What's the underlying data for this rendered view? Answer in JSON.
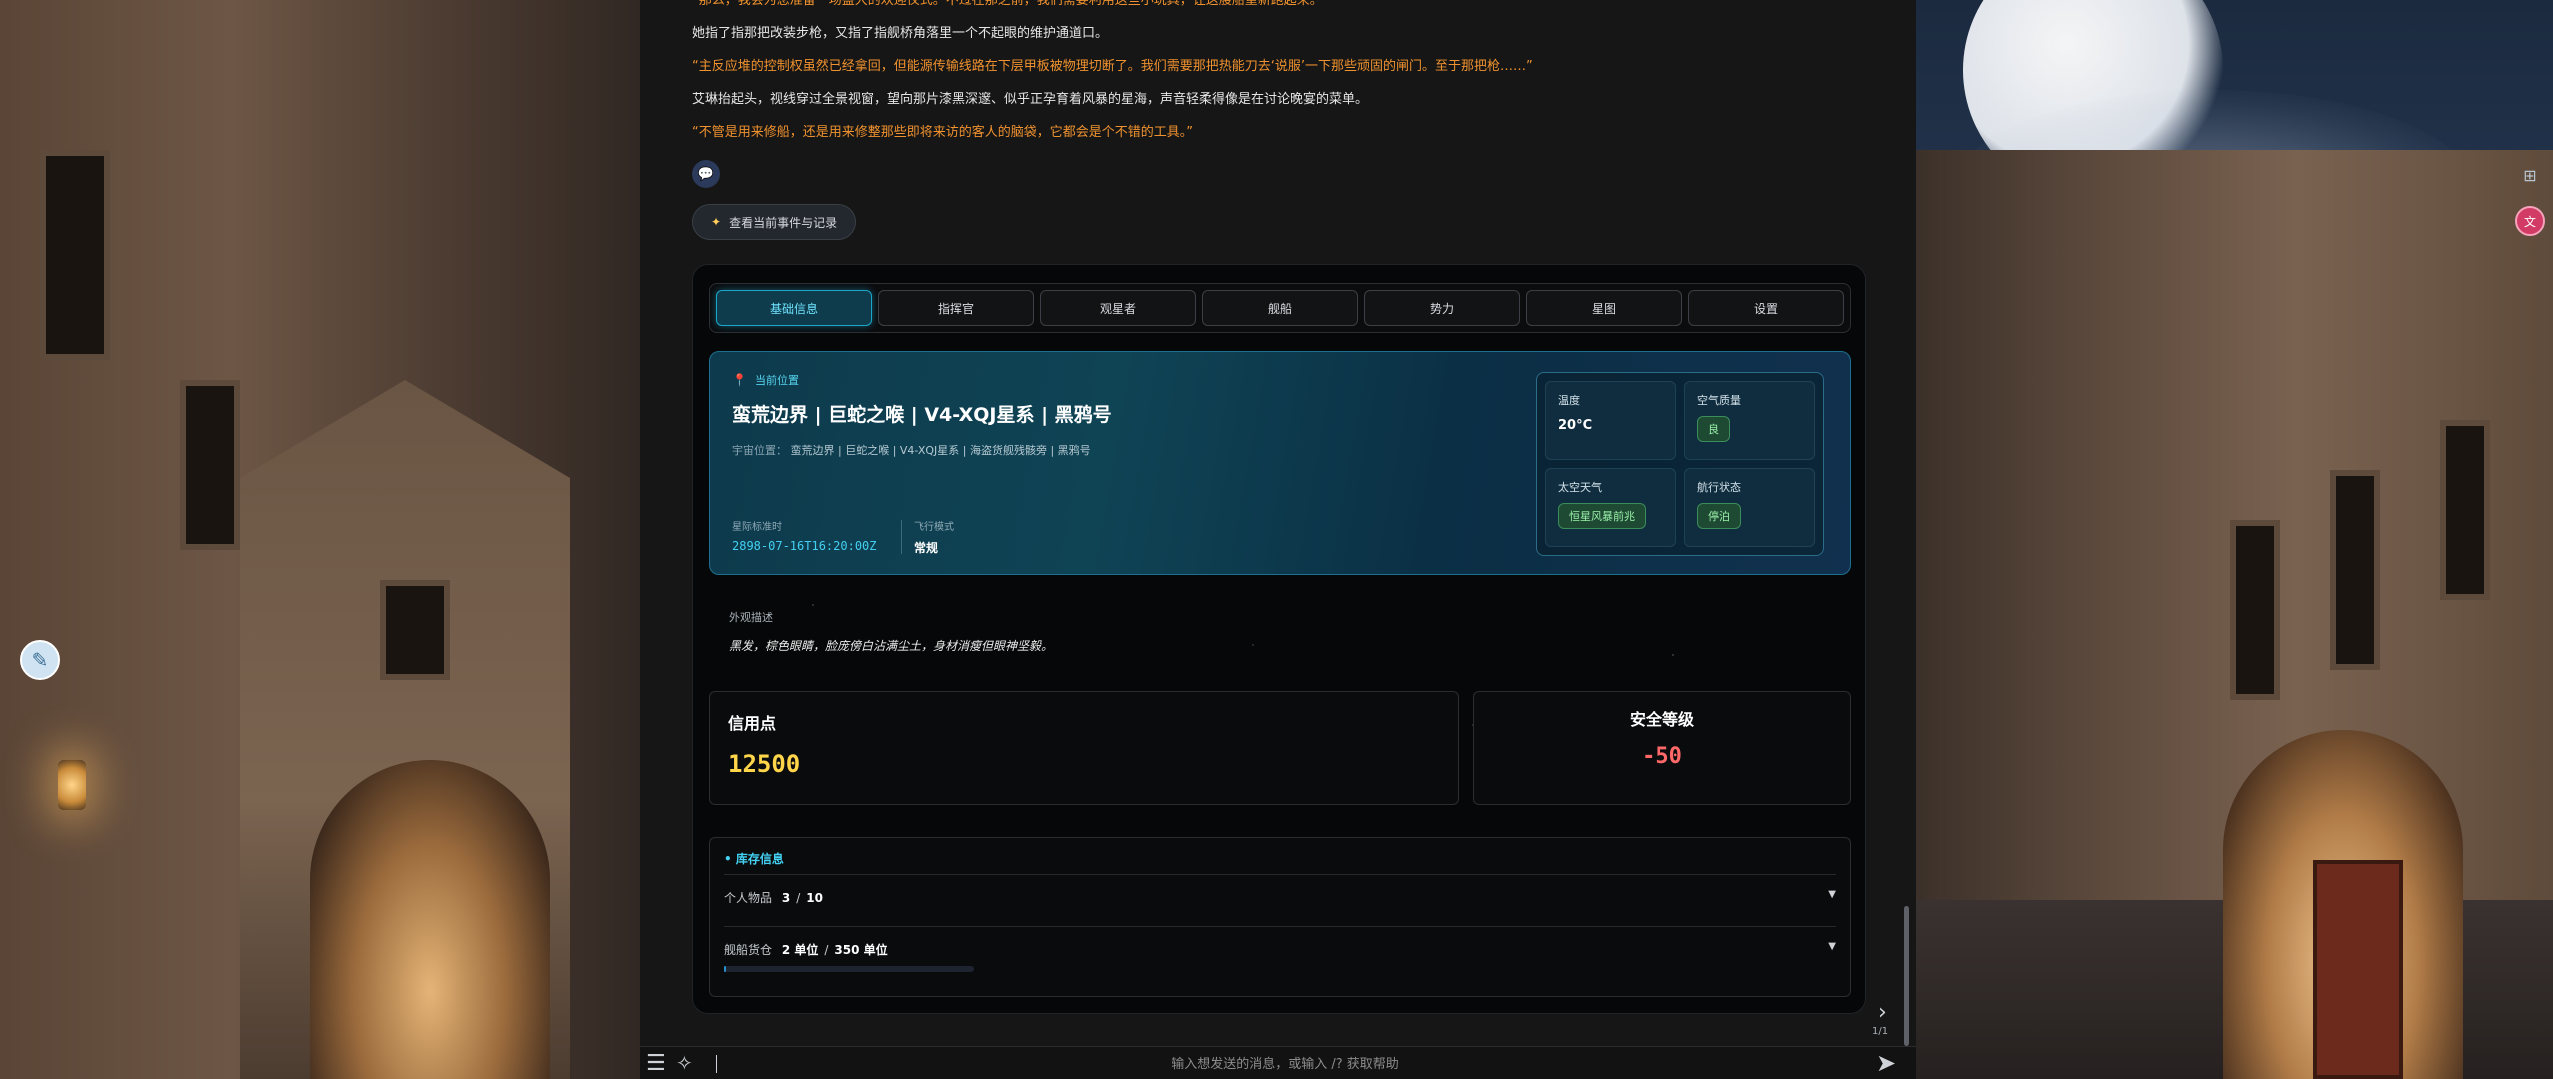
{
  "story": [
    {
      "style": "orange",
      "text": "“那么，我会为您准备一场盛大的欢迎仪式。不过在那之前，我们需要利用这些小玩具，让这艘船重新跑起来。”"
    },
    {
      "style": "white",
      "text": "她指了指那把改装步枪，又指了指舰桥角落里一个不起眼的维护通道口。"
    },
    {
      "style": "orange",
      "text": "“主反应堆的控制权虽然已经拿回，但能源传输线路在下层甲板被物理切断了。我们需要那把热能刀去‘说服’一下那些顽固的闸门。至于那把枪……”"
    },
    {
      "style": "white",
      "text": "艾琳抬起头，视线穿过全景视窗，望向那片漆黑深邃、似乎正孕育着风暴的星海，声音轻柔得像是在讨论晚宴的菜单。"
    },
    {
      "style": "orange",
      "text": "“不管是用来修船，还是用来修整那些即将来访的客人的脑袋，它都会是个不错的工具。”"
    }
  ],
  "events_button": "查看当前事件与记录",
  "tabs": [
    "基础信息",
    "指挥官",
    "观星者",
    "舰船",
    "势力",
    "星图",
    "设置"
  ],
  "location": {
    "tag": "当前位置",
    "title": "蛮荒边界 | 巨蛇之喉 | V4-XQJ星系 | 黑鸦号",
    "sub_key": "宇宙位置：",
    "sub_value": "蛮荒边界 | 巨蛇之喉 | V4-XQJ星系 | 海盗货舰残骸旁 | 黑鸦号",
    "time_label": "星际标准时",
    "time_value": "2898-07-16T16:20:00Z",
    "mode_label": "飞行模式",
    "mode_value": "常规"
  },
  "environment": {
    "temperature_label": "温度",
    "temperature_value": "20°C",
    "air_label": "空气质量",
    "air_value": "良",
    "weather_label": "太空天气",
    "weather_value": "恒星风暴前兆",
    "nav_label": "航行状态",
    "nav_value": "停泊"
  },
  "appearance": {
    "label": "外观描述",
    "text": "黑发，棕色眼睛，脸庞傍白沾满尘土，身材消瘦但眼神坚毅。"
  },
  "credits": {
    "label": "信用点",
    "value": "12500"
  },
  "safety": {
    "label": "安全等级",
    "value": "-50"
  },
  "inventory": {
    "title": "库存信息",
    "personal_label": "个人物品",
    "personal_current": "3",
    "personal_max": "10",
    "cargo_label": "舰船货仓",
    "cargo_current": "2 单位",
    "cargo_max": "350 单位",
    "cargo_fill": 0.006
  },
  "pager": "1/1",
  "input": {
    "placeholder": "输入想发送的消息，或输入 /? 获取帮助"
  },
  "colors": {
    "accent": "#43d0f2",
    "credit": "#ffd54a",
    "danger": "#ff6868",
    "story_highlight": "#f0922f"
  }
}
